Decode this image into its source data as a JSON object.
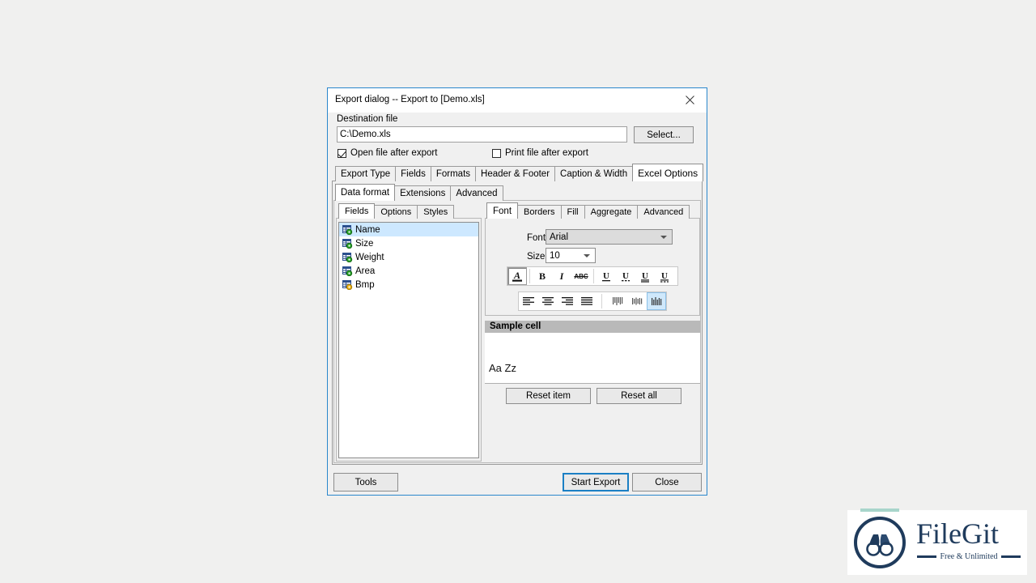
{
  "dialog": {
    "title": "Export dialog -- Export to [Demo.xls]",
    "close_icon": "close-icon"
  },
  "destination": {
    "label": "Destination file",
    "value": "C:\\Demo.xls",
    "placeholder": "C:\\Demo.xls",
    "select_button": "Select...",
    "open_after_export": {
      "label": "Open file after export",
      "checked": true
    },
    "print_after_export": {
      "label": "Print file after export",
      "checked": false
    }
  },
  "tabs_level1": {
    "items": [
      {
        "label": "Export Type",
        "active": false
      },
      {
        "label": "Fields",
        "active": false
      },
      {
        "label": "Formats",
        "active": false
      },
      {
        "label": "Header & Footer",
        "active": false
      },
      {
        "label": "Caption & Width",
        "active": false
      },
      {
        "label": "Excel Options",
        "active": true
      }
    ]
  },
  "tabs_level2": {
    "items": [
      {
        "label": "Data format",
        "active": true
      },
      {
        "label": "Extensions",
        "active": false
      },
      {
        "label": "Advanced",
        "active": false
      }
    ]
  },
  "tabs_left": {
    "items": [
      {
        "label": "Fields",
        "active": true
      },
      {
        "label": "Options",
        "active": false
      },
      {
        "label": "Styles",
        "active": false
      }
    ]
  },
  "field_list": {
    "items": [
      {
        "label": "Name",
        "selected": true,
        "gear": "#2aa32a"
      },
      {
        "label": "Size",
        "selected": false,
        "gear": "#2aa32a"
      },
      {
        "label": "Weight",
        "selected": false,
        "gear": "#2aa32a"
      },
      {
        "label": "Area",
        "selected": false,
        "gear": "#2aa32a"
      },
      {
        "label": "Bmp",
        "selected": false,
        "gear": "#e8b014"
      }
    ]
  },
  "tabs_right": {
    "items": [
      {
        "label": "Font",
        "active": true
      },
      {
        "label": "Borders",
        "active": false
      },
      {
        "label": "Fill",
        "active": false
      },
      {
        "label": "Aggregate",
        "active": false
      },
      {
        "label": "Advanced",
        "active": false
      }
    ]
  },
  "font_panel": {
    "font_label": "Font",
    "font_value": "Arial",
    "size_label": "Size",
    "size_value": "10",
    "toolbar_style": [
      {
        "name": "font-color-icon",
        "glyph": "A",
        "state": "pressed"
      },
      {
        "name": "bold-icon",
        "glyph": "B",
        "state": "normal"
      },
      {
        "name": "italic-icon",
        "glyph": "I",
        "state": "normal"
      },
      {
        "name": "strikethrough-icon",
        "glyph": "ABC",
        "state": "normal"
      },
      {
        "name": "underline-single-icon",
        "glyph": "U",
        "state": "normal"
      },
      {
        "name": "underline-dotted-icon",
        "glyph": "U",
        "state": "normal"
      },
      {
        "name": "underline-double-icon",
        "glyph": "U",
        "state": "normal"
      },
      {
        "name": "underline-double-dotted-icon",
        "glyph": "U",
        "state": "normal"
      }
    ],
    "toolbar_align": [
      {
        "name": "align-left-icon",
        "state": "normal"
      },
      {
        "name": "align-center-icon",
        "state": "normal"
      },
      {
        "name": "align-right-icon",
        "state": "normal"
      },
      {
        "name": "align-justify-icon",
        "state": "normal"
      },
      {
        "name": "valign-top-icon",
        "state": "normal"
      },
      {
        "name": "valign-middle-icon",
        "state": "normal"
      },
      {
        "name": "valign-bottom-icon",
        "state": "selected"
      }
    ]
  },
  "sample": {
    "header": "Sample cell",
    "text": "Aa Zz",
    "header_bg": "#b9b9b9"
  },
  "reset": {
    "item_label": "Reset item",
    "all_label": "Reset all"
  },
  "footer": {
    "tools_label": "Tools",
    "start_label": "Start Export",
    "close_label": "Close",
    "focus_color": "#1b7fc4"
  },
  "watermark": {
    "name": "FileGit",
    "tagline": "Free & Unlimited",
    "brand_color": "#1f3b5c",
    "accent_color": "#a8d5cb",
    "logo_icon": "binoculars-icon"
  }
}
